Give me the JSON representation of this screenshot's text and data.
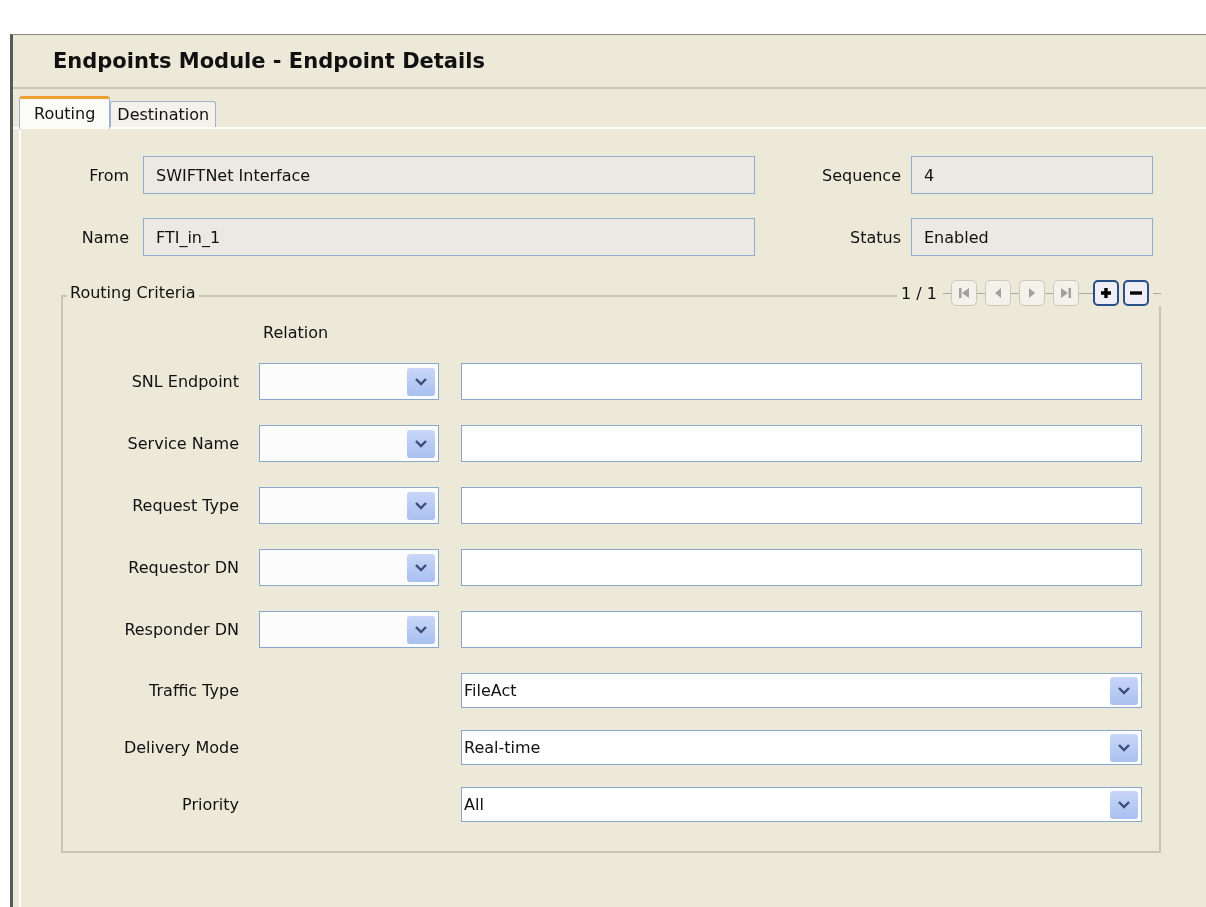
{
  "window": {
    "title": "Endpoints Module - Endpoint Details"
  },
  "tabs": [
    {
      "label": "Routing",
      "selected": true
    },
    {
      "label": "Destination",
      "selected": false
    }
  ],
  "header_fields": [
    {
      "label": "From",
      "value": "SWIFTNet Interface",
      "side_label": "Sequence",
      "side_value": "4"
    },
    {
      "label": "Name",
      "value": "FTI_in_1",
      "side_label": "Status",
      "side_value": "Enabled"
    }
  ],
  "routing_criteria": {
    "title": "Routing Criteria",
    "page": "1 / 1",
    "nav_buttons": [
      {
        "kind": "first",
        "disabled": true
      },
      {
        "kind": "prev",
        "disabled": true
      },
      {
        "kind": "next",
        "disabled": true
      },
      {
        "kind": "last",
        "disabled": true
      }
    ],
    "actions": [
      {
        "kind": "add"
      },
      {
        "kind": "remove"
      }
    ],
    "relation_header": "Relation",
    "rows": [
      {
        "kind": "relation",
        "label": "SNL Endpoint"
      },
      {
        "kind": "relation",
        "label": "Service Name"
      },
      {
        "kind": "relation",
        "label": "Request Type"
      },
      {
        "kind": "relation",
        "label": "Requestor DN"
      },
      {
        "kind": "relation",
        "label": "Responder DN"
      },
      {
        "kind": "choice",
        "label": "Traffic Type",
        "value": "FileAct"
      },
      {
        "kind": "choice",
        "label": "Delivery Mode",
        "value": "Real-time"
      },
      {
        "kind": "choice",
        "label": "Priority",
        "value": "All"
      }
    ]
  }
}
